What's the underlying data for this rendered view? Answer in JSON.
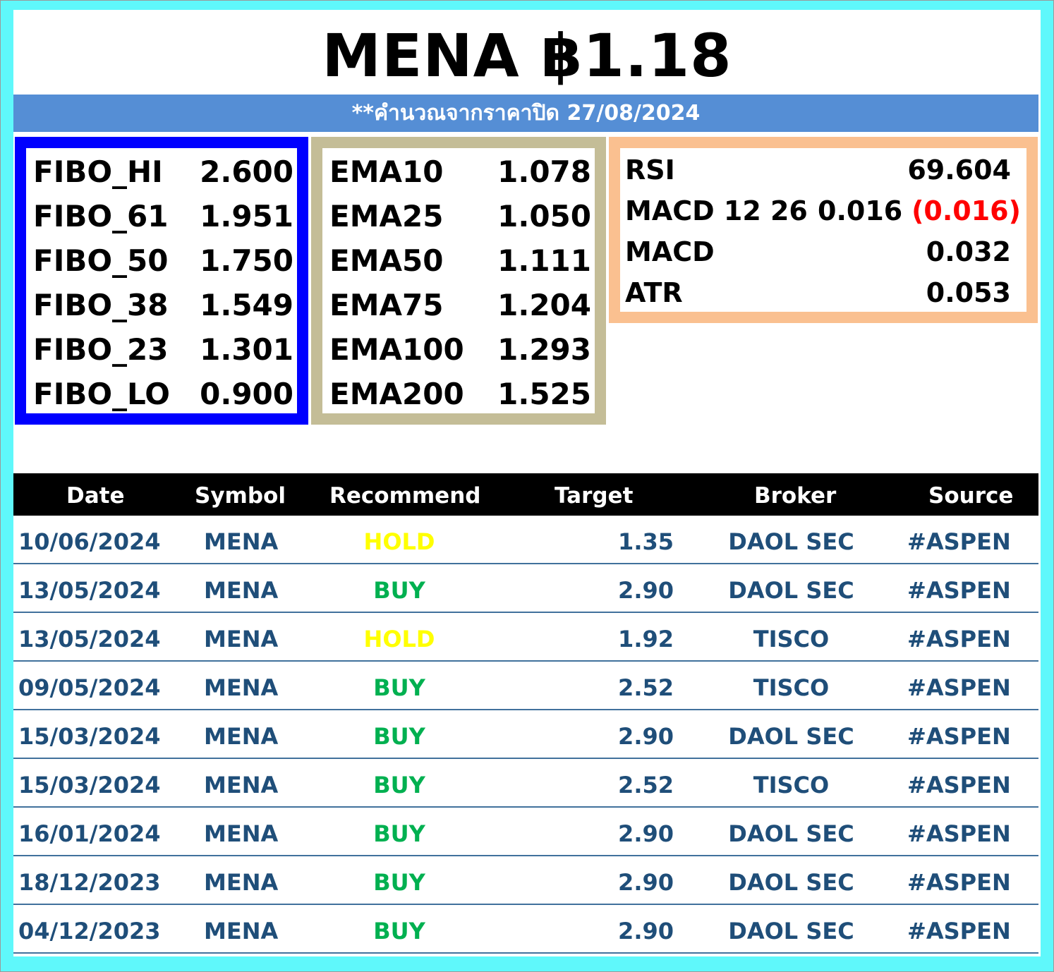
{
  "title": "MENA ฿1.18",
  "subtitle": "**คำนวณจากราคาปิด  27/08/2024",
  "fibo": [
    {
      "label": "FIBO_HI",
      "value": "2.600"
    },
    {
      "label": "FIBO_61",
      "value": "1.951"
    },
    {
      "label": "FIBO_50",
      "value": "1.750"
    },
    {
      "label": "FIBO_38",
      "value": "1.549"
    },
    {
      "label": "FIBO_23",
      "value": "1.301"
    },
    {
      "label": "FIBO_LO",
      "value": "0.900"
    }
  ],
  "ema": [
    {
      "label": "EMA10",
      "value": "1.078"
    },
    {
      "label": "EMA25",
      "value": "1.050"
    },
    {
      "label": "EMA50",
      "value": "1.111"
    },
    {
      "label": "EMA75",
      "value": "1.204"
    },
    {
      "label": "EMA100",
      "value": "1.293"
    },
    {
      "label": "EMA200",
      "value": "1.525"
    }
  ],
  "indicators": {
    "rsi": {
      "label": "RSI",
      "value": "69.604"
    },
    "macd_1226": {
      "label": "MACD 12 26",
      "value1": "0.016",
      "value2": "(0.016)"
    },
    "macd": {
      "label": "MACD",
      "value": "0.032"
    },
    "atr": {
      "label": "ATR",
      "value": "0.053"
    }
  },
  "table": {
    "headers": {
      "date": "Date",
      "symbol": "Symbol",
      "recommend": "Recommend",
      "target": "Target",
      "broker": "Broker",
      "source": "Source"
    },
    "rows": [
      {
        "date": "10/06/2024",
        "symbol": "MENA",
        "recommend": "HOLD",
        "target": "1.35",
        "broker": "DAOL SEC",
        "source": "#ASPEN"
      },
      {
        "date": "13/05/2024",
        "symbol": "MENA",
        "recommend": "BUY",
        "target": "2.90",
        "broker": "DAOL SEC",
        "source": "#ASPEN"
      },
      {
        "date": "13/05/2024",
        "symbol": "MENA",
        "recommend": "HOLD",
        "target": "1.92",
        "broker": "TISCO",
        "source": "#ASPEN"
      },
      {
        "date": "09/05/2024",
        "symbol": "MENA",
        "recommend": "BUY",
        "target": "2.52",
        "broker": "TISCO",
        "source": "#ASPEN"
      },
      {
        "date": "15/03/2024",
        "symbol": "MENA",
        "recommend": "BUY",
        "target": "2.90",
        "broker": "DAOL SEC",
        "source": "#ASPEN"
      },
      {
        "date": "15/03/2024",
        "symbol": "MENA",
        "recommend": "BUY",
        "target": "2.52",
        "broker": "TISCO",
        "source": "#ASPEN"
      },
      {
        "date": "16/01/2024",
        "symbol": "MENA",
        "recommend": "BUY",
        "target": "2.90",
        "broker": "DAOL SEC",
        "source": "#ASPEN"
      },
      {
        "date": "18/12/2023",
        "symbol": "MENA",
        "recommend": "BUY",
        "target": "2.90",
        "broker": "DAOL SEC",
        "source": "#ASPEN"
      },
      {
        "date": "04/12/2023",
        "symbol": "MENA",
        "recommend": "BUY",
        "target": "2.90",
        "broker": "DAOL SEC",
        "source": "#ASPEN"
      }
    ]
  },
  "colors": {
    "frame": "#5ff8fb",
    "subbar": "#558ed5",
    "fibo_border": "#0000ff",
    "ema_border": "#c4bd97",
    "indicator_border": "#fac090",
    "table_text": "#1f4e79",
    "hold": "#ffff00",
    "buy": "#00b050",
    "negative": "#ff0000"
  }
}
